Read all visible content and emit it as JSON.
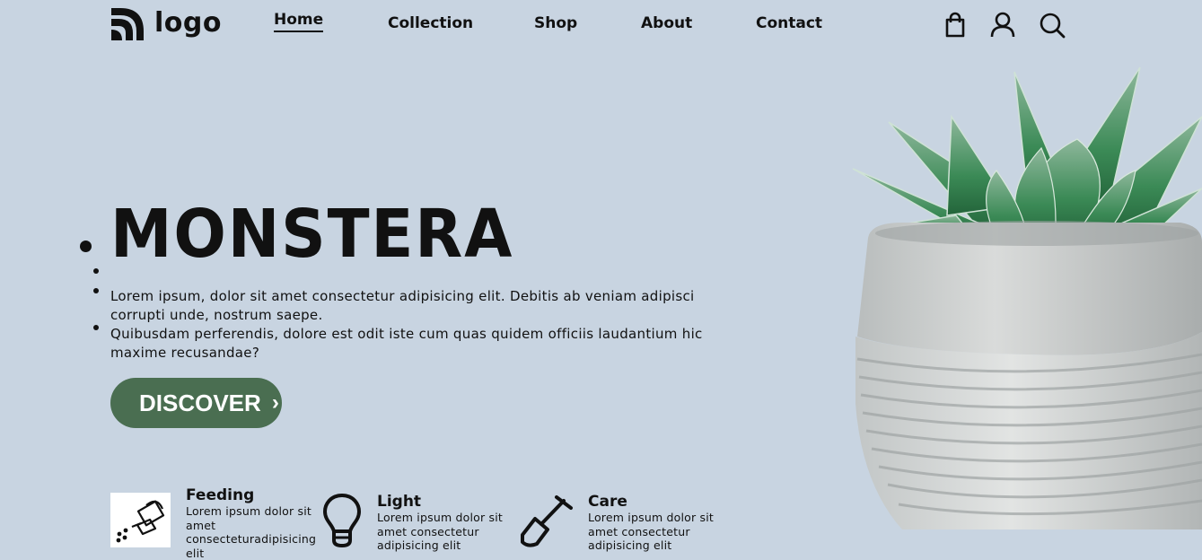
{
  "header": {
    "logo_text": "logo",
    "nav": [
      {
        "label": "Home",
        "active": true
      },
      {
        "label": "Collection",
        "active": false
      },
      {
        "label": "Shop",
        "active": false
      },
      {
        "label": "About",
        "active": false
      },
      {
        "label": "Contact",
        "active": false
      }
    ],
    "icons": [
      "shopping-bag-icon",
      "user-icon",
      "search-icon"
    ]
  },
  "hero": {
    "title": "MONSTERA",
    "paragraphs": [
      "Lorem ipsum, dolor sit amet consectetur adipisicing elit. Debitis ab veniam adipisci corrupti unde, nostrum saepe.",
      "Quibusdam perferendis, dolore est odit iste cum quas quidem officiis laudantium hic maxime recusandae?"
    ],
    "cta_label": "DISCOVER",
    "cta_icon": "chevron-right-icon"
  },
  "features": [
    {
      "title": "Feeding",
      "text": "Lorem ipsum dolor sit amet consecteturadipisicing elit",
      "icon": "watering-can-icon"
    },
    {
      "title": "Light",
      "text": "Lorem ipsum dolor sit amet consectetur adipisicing elit",
      "icon": "light-bulb-icon"
    },
    {
      "title": "Care",
      "text": "Lorem ipsum dolor sit amet consectetur adipisicing elit",
      "icon": "shovel-icon"
    }
  ],
  "colors": {
    "background": "#c8d4e1",
    "accent": "#4a6e51",
    "text": "#111111"
  }
}
